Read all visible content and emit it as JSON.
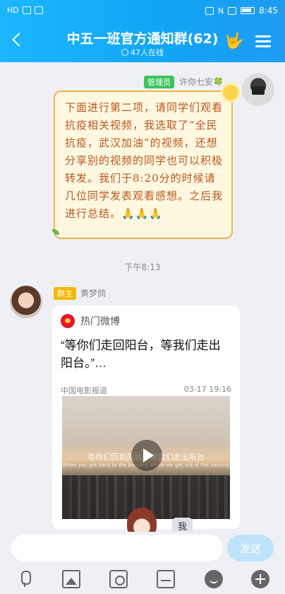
{
  "status_bar": {
    "left_text": "HD",
    "time": "8:45",
    "nfc_label": "N"
  },
  "header": {
    "title": "中五一班官方通知群(62)",
    "online": "47人在线"
  },
  "messages": [
    {
      "role_tag": "管理员",
      "sender": "许你七安🍀",
      "text": "下面进行第二项，请同学们观看抗疫相关视频，我选取了“全民抗疫，武汉加油”的视频，还想分享别的视频的同学也可以积极转发。我们于8:20分的时候请几位同学发表观看感想。之后我进行总结。🙏🙏🙏"
    },
    {
      "role_tag": "群主",
      "sender": "黄梦鸽",
      "card": {
        "source": "热门微博",
        "headline": "“等你们走回阳台，等我们走出阳台。”…",
        "publisher": "中国电影报道",
        "date": "03-17 19:16",
        "video_subtitle_cn": "等你们回到阳台，等我们走出阳台",
        "video_subtitle_en": "When you get back to the balcony, When we get out of the balcony"
      }
    }
  ],
  "timestamp": "下午8:13",
  "me_label": "我",
  "input": {
    "placeholder": "",
    "send_label": "发送"
  },
  "colors": {
    "header_gradient_start": "#1cb6ff",
    "header_gradient_end": "#1e9cf2",
    "bubble_border": "#f2b24a",
    "bubble_text": "#b9561e",
    "admin_tag": "#3cc55c",
    "owner_tag": "#f5b800",
    "send_button": "#bfe3fb"
  },
  "toolbar_icons": [
    "microphone-icon",
    "image-icon",
    "camera-icon",
    "gift-icon",
    "emoji-icon",
    "plus-icon"
  ]
}
